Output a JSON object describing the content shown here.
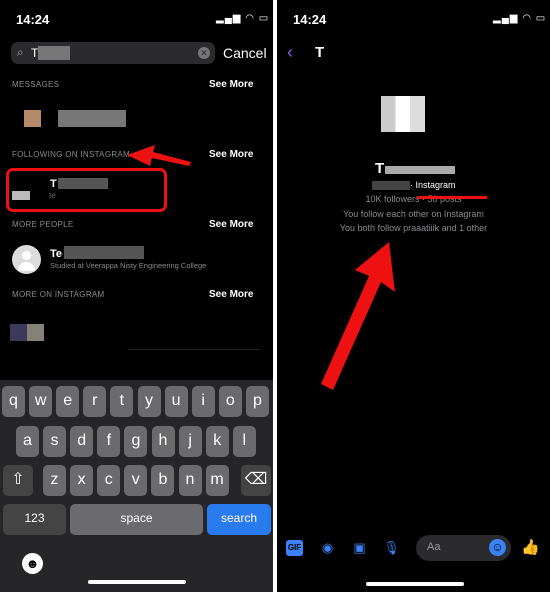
{
  "left": {
    "status_time": "14:24",
    "search": {
      "value": "T",
      "clear_icon": "clear-icon"
    },
    "cancel": "Cancel",
    "sections": [
      {
        "title": "MESSAGES",
        "see_more": "See More"
      },
      {
        "title": "FOLLOWING ON INSTAGRAM",
        "see_more": "See More"
      },
      {
        "title": "MORE PEOPLE",
        "see_more": "See More"
      },
      {
        "title": "MORE ON INSTAGRAM",
        "see_more": "See More"
      }
    ],
    "following_result": {
      "name": "T",
      "username": "te"
    },
    "people_result": {
      "name": "Te",
      "subtitle": "Studied at Veerappa Nisty Engineering College"
    },
    "keyboard": {
      "row1": [
        "q",
        "w",
        "e",
        "r",
        "t",
        "y",
        "u",
        "i",
        "o",
        "p"
      ],
      "row2": [
        "a",
        "s",
        "d",
        "f",
        "g",
        "h",
        "j",
        "k",
        "l"
      ],
      "row3": [
        "z",
        "x",
        "c",
        "v",
        "b",
        "n",
        "m"
      ],
      "numbers": "123",
      "space": "space",
      "search": "search"
    },
    "annotation_color": "#e11"
  },
  "right": {
    "status_time": "14:24",
    "header_name": "T",
    "profile": {
      "name": "T",
      "source": "· Instagram",
      "stats": "10K followers · 50 posts",
      "mutual": "You follow each other on Instagram",
      "common": "You both follow praaatiiik and 1 other"
    },
    "composer": {
      "placeholder": "Aa"
    },
    "accent": "#3b82f6"
  }
}
